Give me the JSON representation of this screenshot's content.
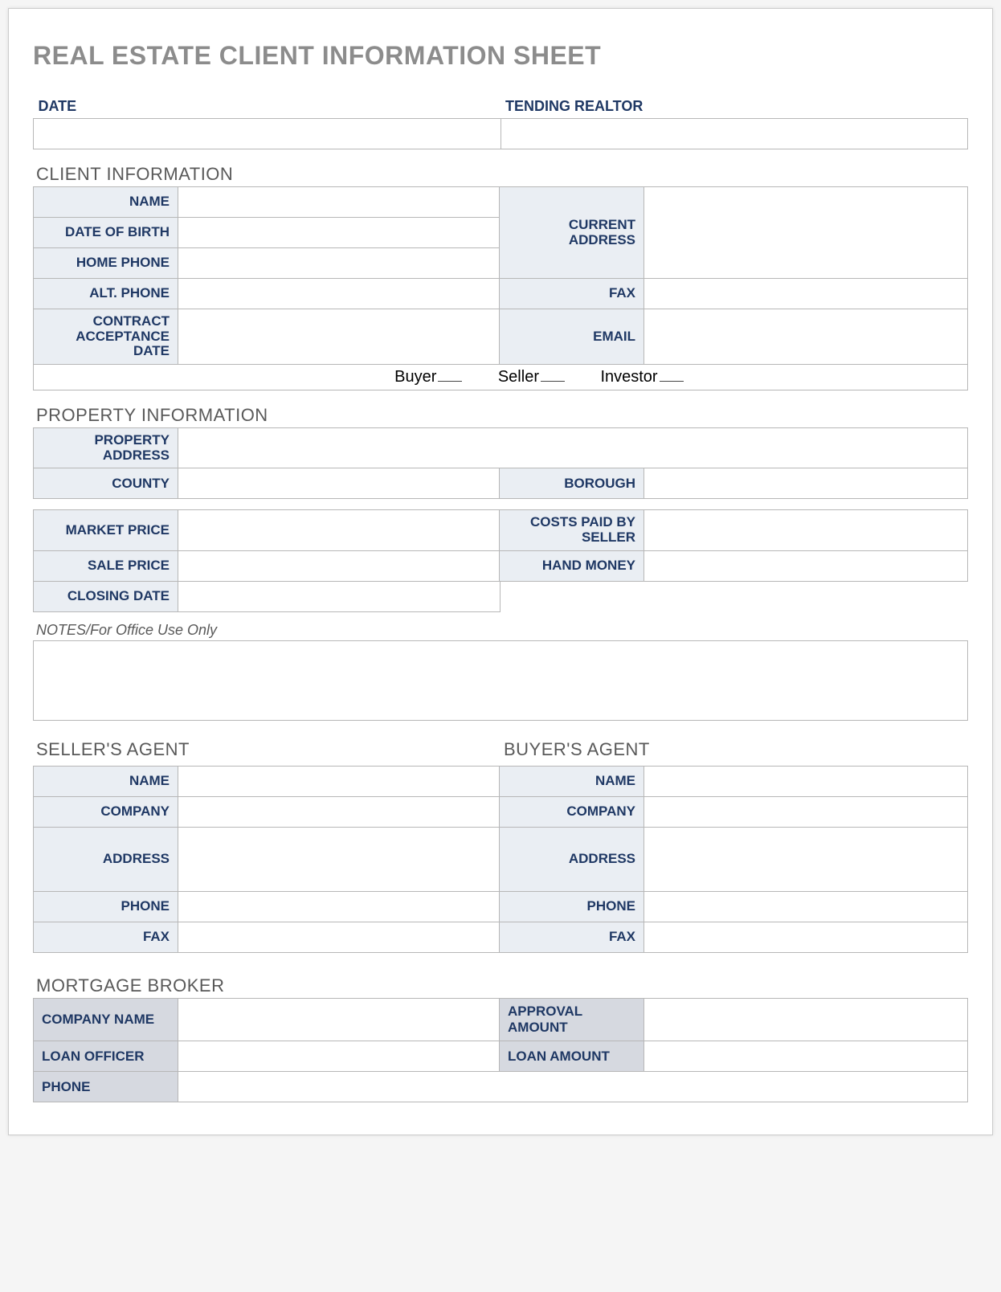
{
  "title": "REAL ESTATE CLIENT INFORMATION SHEET",
  "top": {
    "date_label": "DATE",
    "realtor_label": "TENDING REALTOR",
    "date_value": "",
    "realtor_value": ""
  },
  "client": {
    "section": "CLIENT INFORMATION",
    "name_label": "NAME",
    "dob_label": "DATE OF BIRTH",
    "home_phone_label": "HOME PHONE",
    "alt_phone_label": "ALT. PHONE",
    "contract_label": "CONTRACT ACCEPTANCE DATE",
    "current_address_label": "CURRENT ADDRESS",
    "fax_label": "FAX",
    "email_label": "EMAIL",
    "name": "",
    "dob": "",
    "home_phone": "",
    "alt_phone": "",
    "contract_date": "",
    "current_address": "",
    "fax": "",
    "email": "",
    "role_buyer": "Buyer",
    "role_seller": "Seller",
    "role_investor": "Investor"
  },
  "property": {
    "section": "PROPERTY INFORMATION",
    "address_label": "PROPERTY ADDRESS",
    "county_label": "COUNTY",
    "borough_label": "BOROUGH",
    "market_price_label": "MARKET PRICE",
    "costs_paid_label": "COSTS PAID BY SELLER",
    "sale_price_label": "SALE PRICE",
    "hand_money_label": "HAND MONEY",
    "closing_date_label": "CLOSING DATE",
    "address": "",
    "county": "",
    "borough": "",
    "market_price": "",
    "costs_paid": "",
    "sale_price": "",
    "hand_money": "",
    "closing_date": ""
  },
  "notes": {
    "label": "NOTES/For Office Use Only",
    "value": ""
  },
  "seller_agent": {
    "section": "SELLER'S AGENT",
    "name_label": "NAME",
    "company_label": "COMPANY",
    "address_label": "ADDRESS",
    "phone_label": "PHONE",
    "fax_label": "FAX",
    "name": "",
    "company": "",
    "address": "",
    "phone": "",
    "fax": ""
  },
  "buyer_agent": {
    "section": "BUYER'S AGENT",
    "name_label": "NAME",
    "company_label": "COMPANY",
    "address_label": "ADDRESS",
    "phone_label": "PHONE",
    "fax_label": "FAX",
    "name": "",
    "company": "",
    "address": "",
    "phone": "",
    "fax": ""
  },
  "mortgage": {
    "section": "MORTGAGE BROKER",
    "company_name_label": "COMPANY NAME",
    "approval_amount_label": "APPROVAL AMOUNT",
    "loan_officer_label": "LOAN OFFICER",
    "loan_amount_label": "LOAN AMOUNT",
    "phone_label": "PHONE",
    "company_name": "",
    "approval_amount": "",
    "loan_officer": "",
    "loan_amount": "",
    "phone": ""
  }
}
